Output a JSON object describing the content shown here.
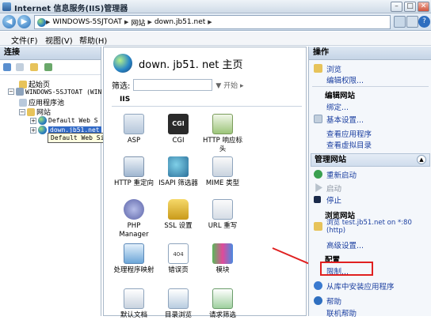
{
  "window": {
    "title": "Internet 信息服务(IIS)管理器"
  },
  "nav": {
    "breadcrumb": [
      "WINDOWS-5SJTOAT",
      "网站",
      "down.jb51.net"
    ]
  },
  "menu": [
    "文件(F)",
    "视图(V)",
    "帮助(H)"
  ],
  "connections": {
    "header": "连接",
    "tree": [
      {
        "label": "起始页"
      },
      {
        "label": "WINDOWS-5SJTOAT (WIN"
      },
      {
        "label": "应用程序池"
      },
      {
        "label": "网站"
      },
      {
        "label": "Default Web S"
      },
      {
        "label": "down.jb51.net"
      }
    ],
    "tooltip": "Default Web Site"
  },
  "main": {
    "title": "down. jb51. net  主页",
    "filter_label": "筛选:",
    "start_label": "开始",
    "group": "IIS",
    "features": [
      "ASP",
      "CGI",
      "HTTP 响应标头",
      "HTTP 重定向",
      "ISAPI 筛选器",
      "MIME 类型",
      "PHP Manager",
      "SSL 设置",
      "URL 重写",
      "处理程序映射",
      "错误页",
      "模块",
      "默认文档",
      "目录浏览",
      "请求筛选"
    ],
    "cgi_text": "CGI",
    "err_text": "404"
  },
  "actions": {
    "header": "操作",
    "browse": "浏览",
    "edit_perms": "编辑权限...",
    "edit_site": "编辑网站",
    "bindings": "绑定...",
    "basic_settings": "基本设置...",
    "view_apps": "查看应用程序",
    "view_vdirs": "查看虚拟目录",
    "manage_site": "管理网站",
    "restart": "重新启动",
    "start": "启动",
    "stop": "停止",
    "browse_site": "浏览网站",
    "browse_link": "浏览 test.jb51.net on *:80 (http)",
    "advanced": "高级设置...",
    "config": "配置",
    "limits": "限制...",
    "install_gallery": "从库中安装应用程序",
    "help": "帮助",
    "online_help": "联机帮助"
  }
}
